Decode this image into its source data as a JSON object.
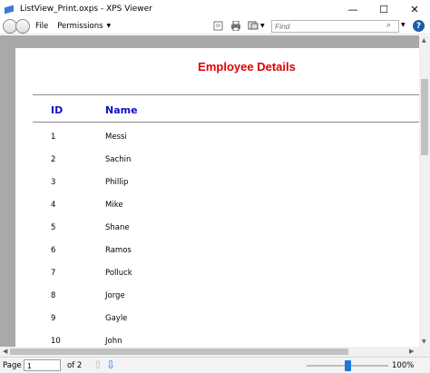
{
  "window": {
    "title": "ListView_Print.oxps - XPS Viewer",
    "minimize": "—",
    "maximize": "☐",
    "close": "✕"
  },
  "toolbar": {
    "menus": [
      {
        "label": "File"
      },
      {
        "label": "Permissions"
      }
    ],
    "find_placeholder": "Find",
    "icons": [
      "page-view-icon",
      "print-icon",
      "page-setup-icon",
      "search-icon",
      "help-icon"
    ]
  },
  "document": {
    "title": "Employee Details",
    "headers": {
      "id": "ID",
      "name": "Name"
    },
    "rows": [
      {
        "id": "1",
        "name": "Messi"
      },
      {
        "id": "2",
        "name": "Sachin"
      },
      {
        "id": "3",
        "name": "Phillip"
      },
      {
        "id": "4",
        "name": "Mike"
      },
      {
        "id": "5",
        "name": "Shane"
      },
      {
        "id": "6",
        "name": "Ramos"
      },
      {
        "id": "7",
        "name": "Polluck"
      },
      {
        "id": "8",
        "name": "Jorge"
      },
      {
        "id": "9",
        "name": "Gayle"
      },
      {
        "id": "10",
        "name": "John"
      }
    ]
  },
  "statusbar": {
    "page_label": "Page",
    "page_value": "1",
    "of_label": "of 2",
    "zoom_label": "100%",
    "zoom_fraction": 0.5
  },
  "colors": {
    "title": "#e00000",
    "header": "#1010c8",
    "accent": "#1e78d7"
  }
}
